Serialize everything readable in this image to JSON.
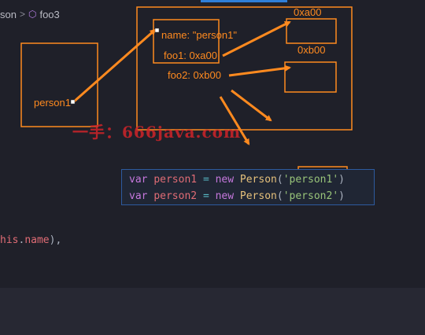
{
  "breadcrumb": {
    "left": "son",
    "separator": ">",
    "icon": "cube-icon",
    "item": "foo3"
  },
  "annotations": {
    "person_box_label": "person1",
    "name_prop": "name: \"person1\"",
    "foo1_prop": "foo1: 0xa00",
    "foo2_prop": "foo2: 0xb00",
    "addr_a": "0xa00",
    "addr_b": "0xb00"
  },
  "watermark": "一手：666java.com",
  "code": {
    "line1": {
      "kw": "var",
      "name": "person1",
      "op": "=",
      "new": "new",
      "cls": "Person",
      "open": "(",
      "arg": "'person1'",
      "close": ")"
    },
    "line2": {
      "kw": "var",
      "name": "person2",
      "op": "=",
      "new": "new",
      "cls": "Person",
      "open": "(",
      "arg": "'person2'",
      "close": ")"
    },
    "this_line": {
      "prefix": "his",
      "dot": ".",
      "prop": "name",
      "suffix": "),"
    }
  },
  "colors": {
    "annotation": "#ff8a1f",
    "background": "#1f2029"
  }
}
